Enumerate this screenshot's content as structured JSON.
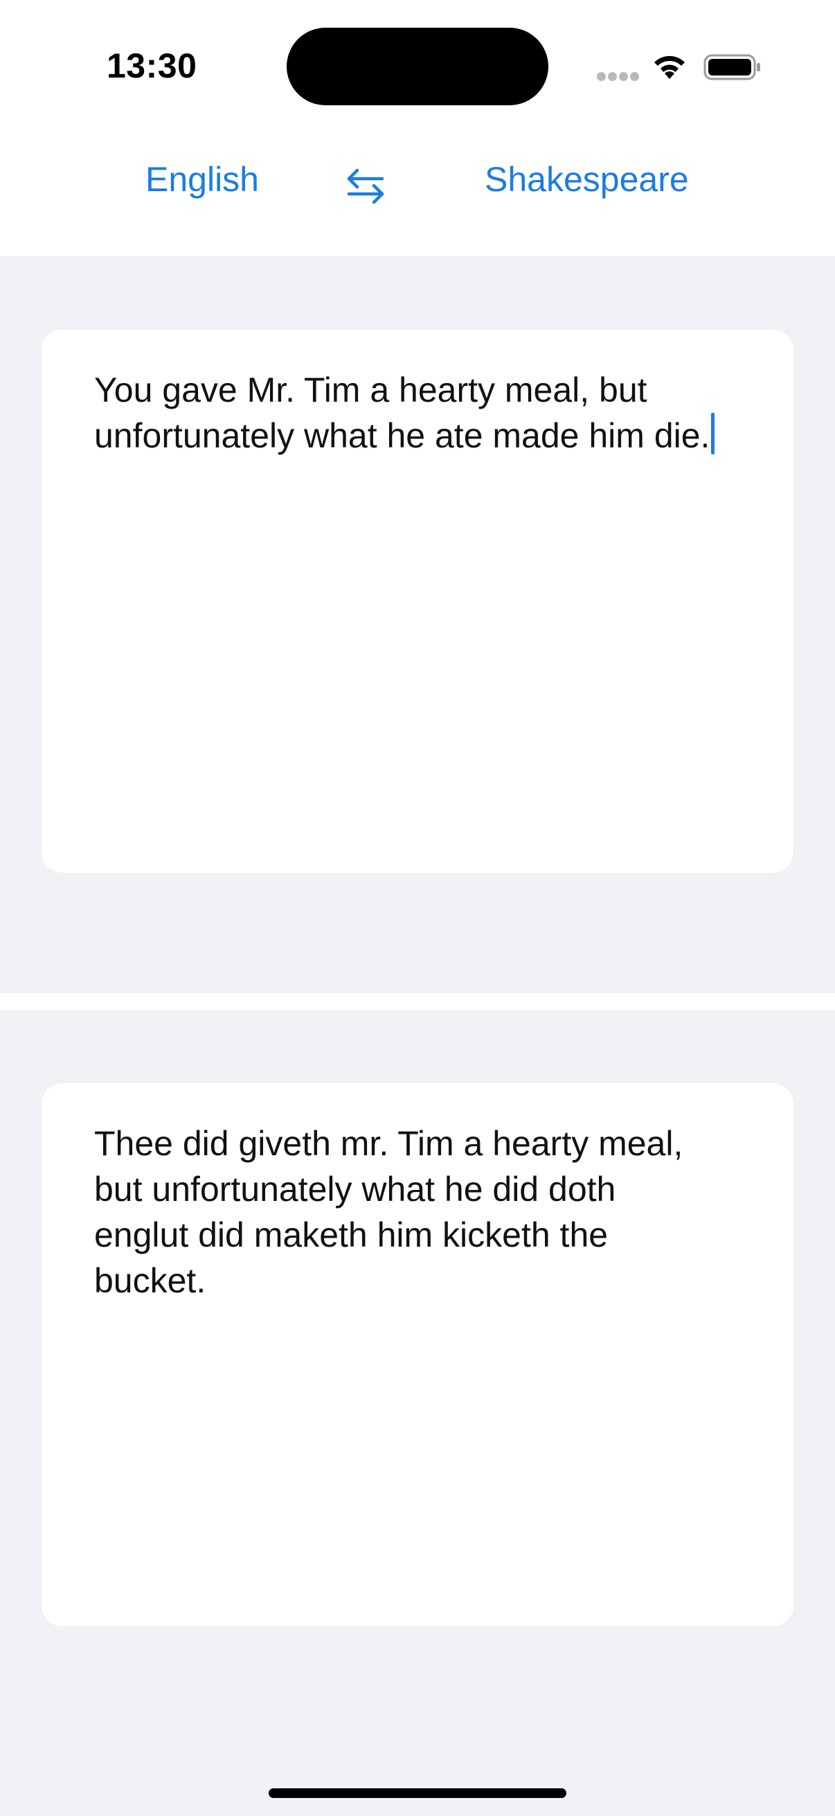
{
  "status_bar": {
    "time": "13:30"
  },
  "language_bar": {
    "source_language": "English",
    "target_language": "Shakespeare",
    "swap_icon": "swap-arrows-icon"
  },
  "input_card": {
    "text": "You gave Mr. Tim a hearty meal, but\nunfortunately what he ate made him die."
  },
  "output_card": {
    "text": "Thee did giveth mr. Tim a hearty meal,\nbut unfortunately what he did doth\nenglut did maketh him kicketh the\nbucket."
  },
  "colors": {
    "accent": "#1a7de0",
    "panel_background": "#f1f1f6",
    "card_background": "#ffffff",
    "text": "#111111"
  }
}
